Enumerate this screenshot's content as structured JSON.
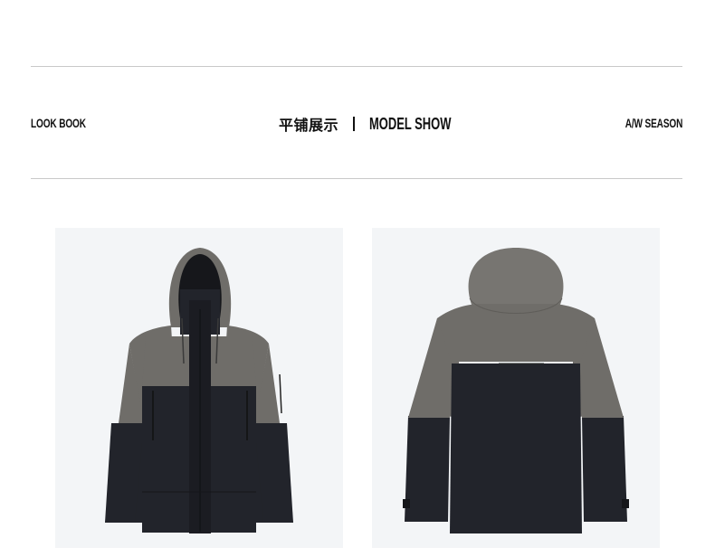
{
  "header": {
    "left_label": "LOOK BOOK",
    "title_zh": "平铺展示",
    "title_en": "MODEL SHOW",
    "right_label": "A/W SEASON"
  },
  "products": [
    {
      "view": "front",
      "print": ""
    },
    {
      "view": "back",
      "print": ""
    }
  ],
  "colors": {
    "upper_panel": "#6f6d69",
    "lower_panel": "#22242b",
    "background": "#f3f5f7"
  }
}
